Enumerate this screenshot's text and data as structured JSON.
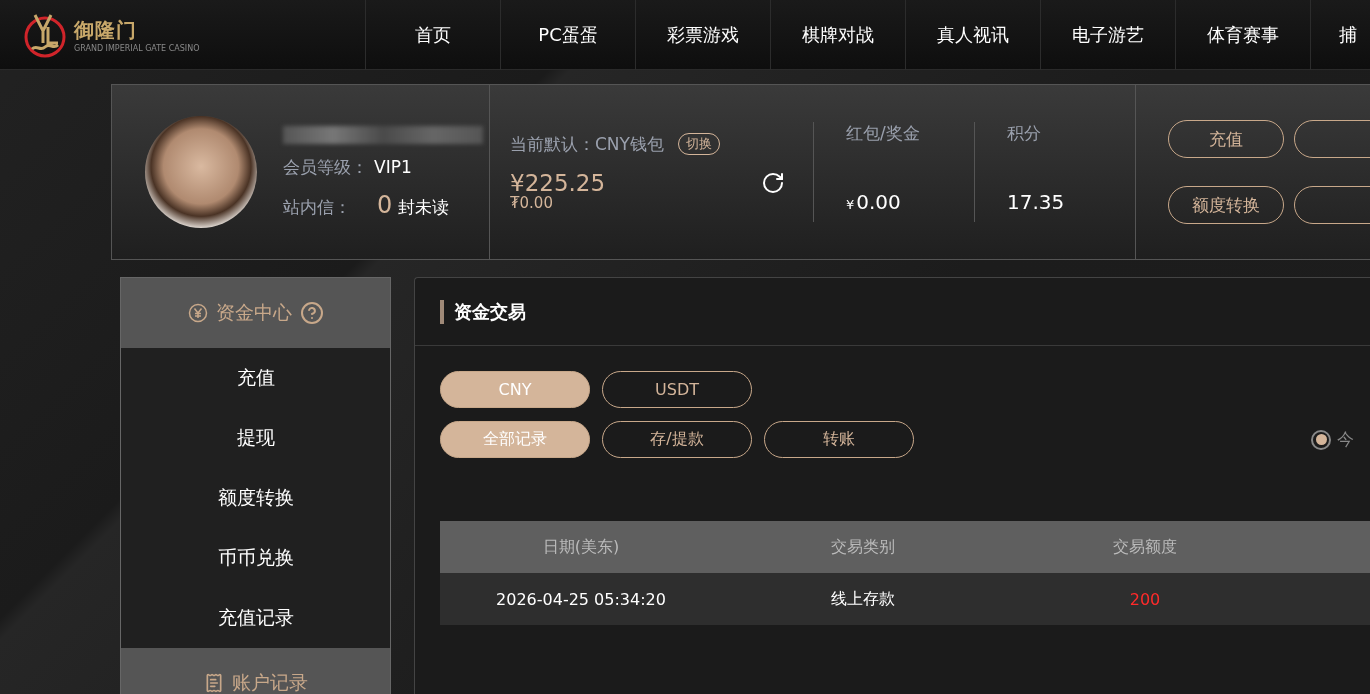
{
  "brand": {
    "name": "御隆门",
    "tagline": "GRAND IMPERIAL GATE CASINO"
  },
  "nav": [
    {
      "label": "首页"
    },
    {
      "label": "PC蛋蛋"
    },
    {
      "label": "彩票游戏"
    },
    {
      "label": "棋牌对战"
    },
    {
      "label": "真人视讯"
    },
    {
      "label": "电子游艺"
    },
    {
      "label": "体育赛事"
    },
    {
      "label": "捕"
    }
  ],
  "profile": {
    "level_label": "会员等级：",
    "level": "VIP1",
    "mail_label": "站内信：",
    "unread_count": "0",
    "unread_suffix": "封未读"
  },
  "wallet": {
    "default_label": "当前默认：CNY钱包",
    "switch_button": "切换",
    "balance": "¥225.25",
    "usdt_balance": "₮0.00",
    "bonus_label": "红包/奖金",
    "bonus_currency": "¥",
    "bonus_value": "0.00",
    "points_label": "积分",
    "points_value": "17.35"
  },
  "actions": [
    {
      "label": "充值"
    },
    {
      "label": "额度转换"
    }
  ],
  "sidebar": {
    "sections": [
      {
        "title": "资金中心",
        "kind": "funds",
        "help": true,
        "items": [
          {
            "label": "充值"
          },
          {
            "label": "提现"
          },
          {
            "label": "额度转换"
          },
          {
            "label": "币币兑换"
          },
          {
            "label": "充值记录"
          }
        ]
      },
      {
        "title": "账户记录",
        "kind": "records",
        "help": false
      }
    ]
  },
  "main": {
    "title": "资金交易",
    "currencies": [
      {
        "label": "CNY",
        "selected": true
      },
      {
        "label": "USDT",
        "selected": false
      }
    ],
    "record_types": [
      {
        "label": "全部记录",
        "selected": true
      },
      {
        "label": "存/提款",
        "selected": false
      },
      {
        "label": "转账",
        "selected": false
      }
    ],
    "range": {
      "label": "今",
      "selected": true
    },
    "table": {
      "columns": [
        "日期(美东)",
        "交易类别",
        "交易额度"
      ],
      "rows": [
        {
          "date": "2026-04-25 05:34:20",
          "type": "线上存款",
          "amount": "200"
        }
      ]
    }
  }
}
